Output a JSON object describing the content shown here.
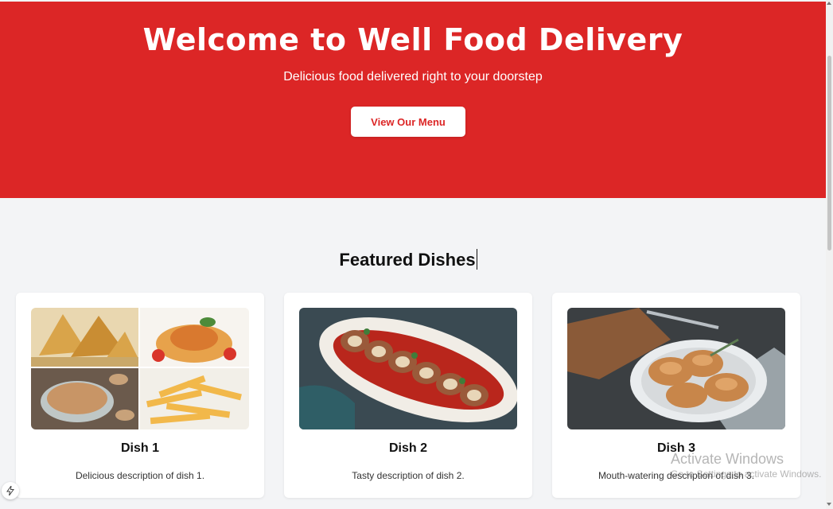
{
  "hero": {
    "title": "Welcome to Well Food Delivery",
    "subtitle": "Delicious food delivered right to your doorstep",
    "cta_label": "View Our Menu"
  },
  "featured": {
    "title": "Featured Dishes",
    "cards": [
      {
        "name": "Dish 1",
        "description": "Delicious description of dish 1.",
        "image_icon": "food-collage-image"
      },
      {
        "name": "Dish 2",
        "description": "Tasty description of dish 2.",
        "image_icon": "stuffed-roll-image"
      },
      {
        "name": "Dish 3",
        "description": "Mouth-watering description of dish 3.",
        "image_icon": "pastry-plate-image"
      }
    ]
  },
  "watermark": {
    "title": "Activate Windows",
    "subtitle": "Go to Settings to activate Windows."
  },
  "colors": {
    "brand_red": "#dc2626",
    "page_background": "#f3f4f6",
    "card_background": "#ffffff"
  }
}
